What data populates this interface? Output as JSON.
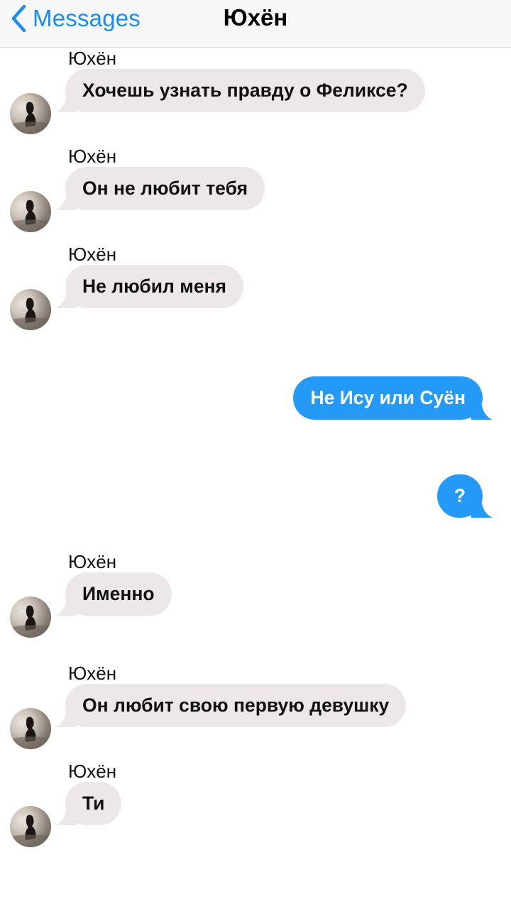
{
  "header": {
    "back_label": "Messages",
    "title": "Юхён",
    "back_icon": "chevron-left-icon",
    "accent_color": "#1a8cf2"
  },
  "messages": [
    {
      "sender": "Юхён",
      "text": "Хочешь узнать правду о Феликсе?",
      "direction": "incoming"
    },
    {
      "sender": "Юхён",
      "text": "Он не любит тебя",
      "direction": "incoming"
    },
    {
      "sender": "Юхён",
      "text": "Не любил меня",
      "direction": "incoming"
    },
    {
      "text": "Не Ису или Суён",
      "direction": "outgoing"
    },
    {
      "text": "?",
      "direction": "outgoing"
    },
    {
      "sender": "Юхён",
      "text": "Именно",
      "direction": "incoming"
    },
    {
      "sender": "Юхён",
      "text": "Он любит свою первую девушку",
      "direction": "incoming"
    },
    {
      "sender": "Юхён",
      "text": "Ти",
      "direction": "incoming"
    }
  ],
  "colors": {
    "incoming_bubble": "#eee7e9",
    "outgoing_bubble": "#2599f6"
  }
}
